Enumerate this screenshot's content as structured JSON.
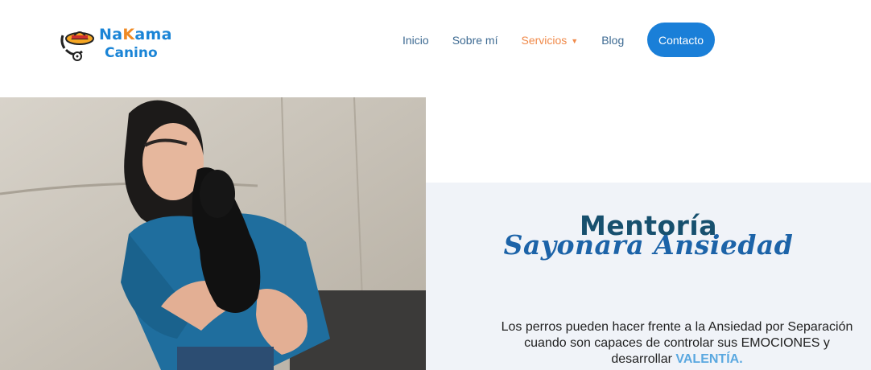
{
  "brand": {
    "line1_a": "Na",
    "line1_k": "K",
    "line1_b": "ama",
    "line2": "Canino"
  },
  "nav": {
    "items": [
      "Inicio",
      "Sobre mí",
      "Servicios",
      "Blog"
    ],
    "active": "Servicios",
    "contact": "Contacto"
  },
  "hero": {
    "title": "Mentoría",
    "subtitle": "Sayonara Ansiedad",
    "text_a": "Los perros pueden hacer frente a la Ansiedad por Separación cuando son capaces de controlar sus EMOCIONES y desarrollar ",
    "text_highlight": "VALENTÍA."
  },
  "colors": {
    "primary": "#1a7fd8",
    "accent": "#f08a4a",
    "title": "#17506e",
    "panel_bg": "#f0f3f8"
  },
  "icons": {
    "caret": "chevron-down-icon"
  }
}
